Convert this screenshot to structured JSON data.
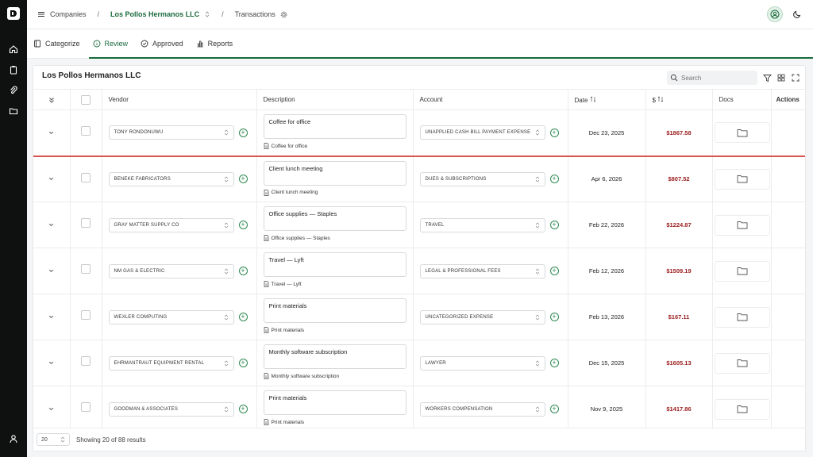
{
  "breadcrumb": {
    "companies": "Companies",
    "company": "Los Pollos Hermanos LLC",
    "page": "Transactions"
  },
  "tabs": [
    {
      "label": "Categorize",
      "icon": "ledger-icon"
    },
    {
      "label": "Review",
      "icon": "info-circle-icon"
    },
    {
      "label": "Approved",
      "icon": "check-circle-icon"
    },
    {
      "label": "Reports",
      "icon": "bar-chart-icon"
    }
  ],
  "card": {
    "title": "Los Pollos Hermanos LLC",
    "search_placeholder": "Search"
  },
  "columns": {
    "vendor": "Vendor",
    "description": "Description",
    "account": "Account",
    "date": "Date",
    "amount": "$",
    "docs": "Docs",
    "actions": "Actions"
  },
  "rows": [
    {
      "vendor": "TONY RONDONUWU",
      "description": "Coffee for office",
      "account": "UNAPPLIED CASH BILL PAYMENT EXPENSE",
      "date": "Dec 23, 2025",
      "amount": "$1867.58"
    },
    {
      "vendor": "BENEKE FABRICATORS",
      "description": "Client lunch meeting",
      "account": "DUES & SUBSCRIPTIONS",
      "date": "Apr 6, 2026",
      "amount": "$807.52"
    },
    {
      "vendor": "GRAY MATTER SUPPLY CO",
      "description": "Office supplies — Staples",
      "account": "TRAVEL",
      "date": "Feb 22, 2026",
      "amount": "$1224.87"
    },
    {
      "vendor": "NM GAS & ELECTRIC",
      "description": "Travel — Lyft",
      "account": "LEGAL & PROFESSIONAL FEES",
      "date": "Feb 12, 2026",
      "amount": "$1509.19"
    },
    {
      "vendor": "WEXLER COMPUTING",
      "description": "Print materials",
      "account": "UNCATEGORIZED EXPENSE",
      "date": "Feb 13, 2026",
      "amount": "$167.11"
    },
    {
      "vendor": "EHRMANTRAUT EQUIPMENT RENTAL",
      "description": "Monthly software subscription",
      "account": "LAWYER",
      "date": "Dec 15, 2025",
      "amount": "$1605.13"
    },
    {
      "vendor": "GOODMAN & ASSOCIATES",
      "description": "Print materials",
      "account": "WORKERS COMPENSATION",
      "date": "Nov 9, 2025",
      "amount": "$1417.86"
    }
  ],
  "footer": {
    "page_size": "20",
    "results_text": "Showing 20 of 88 results"
  },
  "colors": {
    "accent": "#1a6b3c",
    "amount": "#9b1c1c",
    "rail": "#0f1111",
    "separator": "#d9534f"
  }
}
